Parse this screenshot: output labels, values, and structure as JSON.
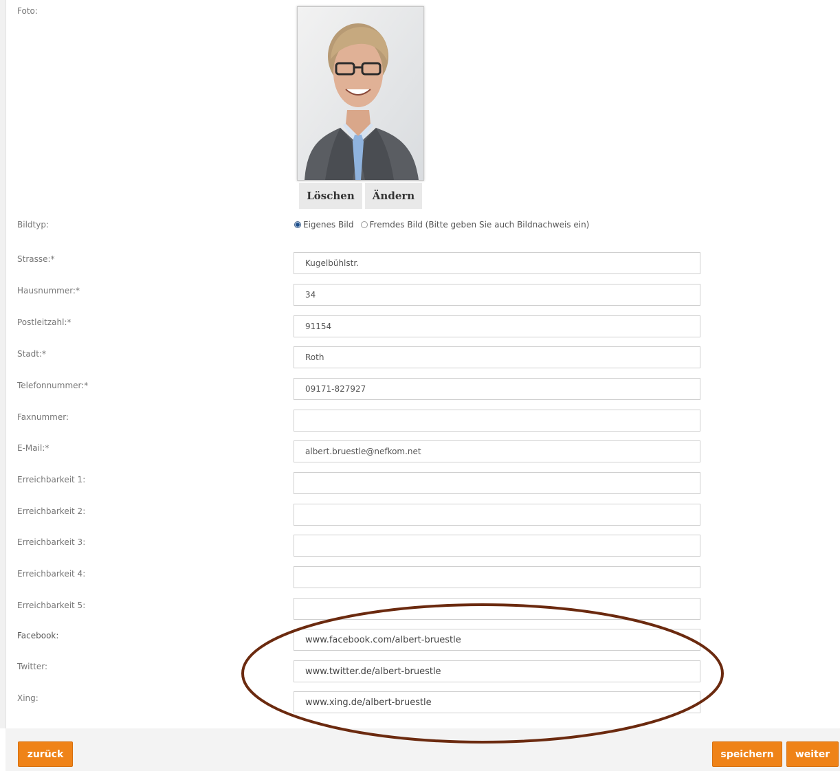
{
  "labels": {
    "foto": "Foto:",
    "bildtyp": "Bildtyp:",
    "strasse": "Strasse:*",
    "hausnummer": "Hausnummer:*",
    "postleitzahl": "Postleitzahl:*",
    "stadt": "Stadt:*",
    "telefon": "Telefonnummer:*",
    "fax": "Faxnummer:",
    "email": "E-Mail:*",
    "erreich1": "Erreichbarkeit 1:",
    "erreich2": "Erreichbarkeit 2:",
    "erreich3": "Erreichbarkeit 3:",
    "erreich4": "Erreichbarkeit 4:",
    "erreich5": "Erreichbarkeit 5:",
    "facebook": "Facebook:",
    "twitter": "Twitter:",
    "xing": "Xing:"
  },
  "photo": {
    "delete_label": "Löschen",
    "change_label": "Ändern"
  },
  "bildtyp": {
    "option_own": "Eigenes Bild",
    "option_foreign": "Fremdes Bild (Bitte geben Sie auch Bildnachweis ein)",
    "selected": "Eigenes Bild"
  },
  "values": {
    "strasse": "Kugelbühlstr.",
    "hausnummer": "34",
    "postleitzahl": "91154",
    "stadt": "Roth",
    "telefon": "09171-827927",
    "fax": "",
    "email": "albert.bruestle@nefkom.net",
    "erreich1": "",
    "erreich2": "",
    "erreich3": "",
    "erreich4": "",
    "erreich5": "",
    "facebook": "www.facebook.com/albert-bruestle",
    "twitter": "www.twitter.de/albert-bruestle",
    "xing": "www.xing.de/albert-bruestle"
  },
  "footer": {
    "back_label": "zurück",
    "save_label": "speichern",
    "next_label": "weiter"
  },
  "colors": {
    "button_orange": "#ef8318",
    "annotation_ellipse": "#6b2a0f"
  }
}
